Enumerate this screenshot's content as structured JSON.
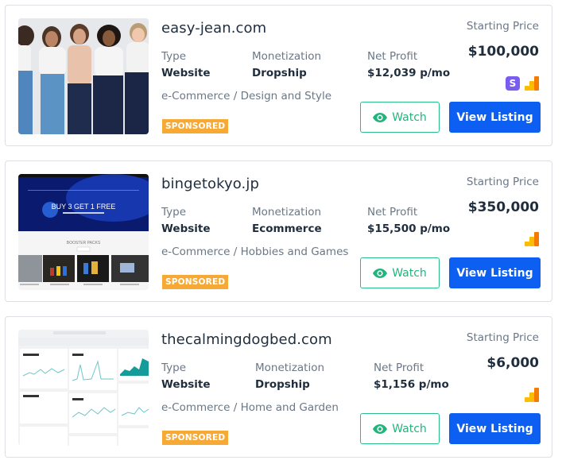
{
  "listings": [
    {
      "title": "easy-jean.com",
      "type_label": "Type",
      "type_value": "Website",
      "monetization_label": "Monetization",
      "monetization_value": "Dropship",
      "net_profit_label": "Net Profit",
      "net_profit_value": "$12,039 p/mo",
      "category": "e-Commerce / Design and Style",
      "badge": "SPONSORED",
      "price_label": "Starting Price",
      "price_value": "$100,000",
      "integrations": [
        "stripe-icon",
        "google-analytics-icon"
      ],
      "stripe_letter": "S",
      "thumbnail": "women-in-jeans-photo",
      "watch_label": "Watch",
      "view_label": "View Listing"
    },
    {
      "title": "bingetokyo.jp",
      "type_label": "Type",
      "type_value": "Website",
      "monetization_label": "Monetization",
      "monetization_value": "Ecommerce",
      "net_profit_label": "Net Profit",
      "net_profit_value": "$15,500 p/mo",
      "category": "e-Commerce / Hobbies and Games",
      "badge": "SPONSORED",
      "price_label": "Starting Price",
      "price_value": "$350,000",
      "integrations": [
        "google-analytics-icon"
      ],
      "thumbnail": "store-homepage-screenshot",
      "thumb_text": {
        "banner": "BUY 3 GET 1 FREE",
        "section": "BOOSTER PACKS"
      },
      "watch_label": "Watch",
      "view_label": "View Listing"
    },
    {
      "title": "thecalmingdogbed.com",
      "type_label": "Type",
      "type_value": "Website",
      "monetization_label": "Monetization",
      "monetization_value": "Dropship",
      "net_profit_label": "Net Profit",
      "net_profit_value": "$1,156 p/mo",
      "category": "e-Commerce / Home and Garden",
      "badge": "SPONSORED",
      "price_label": "Starting Price",
      "price_value": "$6,000",
      "integrations": [
        "google-analytics-icon"
      ],
      "thumbnail": "analytics-dashboard-screenshot",
      "watch_label": "Watch",
      "view_label": "View Listing"
    }
  ],
  "colors": {
    "primary": "#0d5ff2",
    "watch_green": "#22b47c",
    "sponsored": "#f7a935",
    "stripe": "#7b5cf0",
    "ga_yellow": "#fbbc04",
    "ga_orange": "#f57c00"
  }
}
